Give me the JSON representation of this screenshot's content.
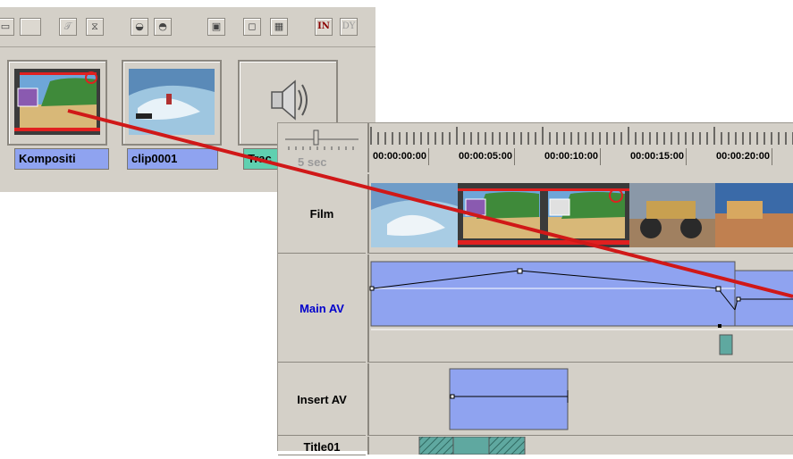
{
  "bin": {
    "toolbar_icons": [
      "filmstrip-icon",
      "title-icon",
      "transition-icon",
      "reverse-icon",
      "forward-icon",
      "fit-icon",
      "restore-icon",
      "maximize-icon",
      "mark-in-icon",
      "mark-out-icon"
    ],
    "toolbar_glyphs": [
      "▭",
      "𝒯",
      "⧖",
      "◒",
      "◓",
      "▣",
      "◻",
      "▦",
      "IN",
      "DY"
    ],
    "clips": [
      {
        "label": "Kompositi",
        "label_color": "#8fa3f0"
      },
      {
        "label": "clip0001",
        "label_color": "#8fa3f0"
      },
      {
        "label": "Trac",
        "label_color": "#5fd0b0"
      }
    ]
  },
  "timeline": {
    "zoom_label": "5 sec",
    "timecodes": [
      "00:00:00:00",
      "00:00:05:00",
      "00:00:10:00",
      "00:00:15:00",
      "00:00:20:00"
    ],
    "tracks": [
      {
        "name": "Film",
        "color": "#000000"
      },
      {
        "name": "Main AV",
        "color": "#0000cc"
      },
      {
        "name": "Insert AV",
        "color": "#000000"
      },
      {
        "name": "Title01",
        "color": "#000000"
      }
    ]
  },
  "colors": {
    "panel": "#d4d0c8",
    "clip_blue": "#8fa3f0",
    "teal": "#5fa8a0",
    "annotation_line": "#d01818"
  }
}
